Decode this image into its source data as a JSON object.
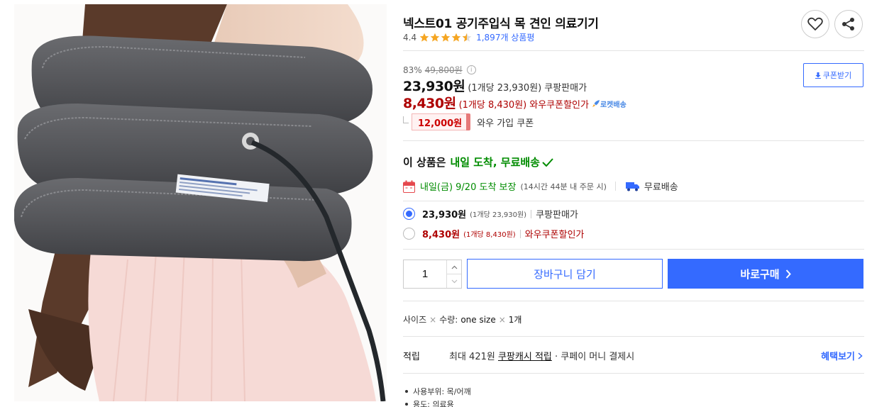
{
  "product": {
    "title": "넥스트01 공기주입식 목 견인 의료기기",
    "rating": "4.4",
    "review_count": "1,897개 상품평",
    "stars_icon": "star-rating-icon"
  },
  "actions": {
    "wishlist_icon": "heart-icon",
    "share_icon": "share-icon"
  },
  "pricing": {
    "discount_rate": "83%",
    "original_price": "49,800원",
    "coupon_button": "쿠폰받기",
    "sale_price": "23,930원",
    "sale_unit": "(1개당 23,930원)",
    "sale_label": "쿠팡판매가",
    "wow_price": "8,430원",
    "wow_unit": "(1개당 8,430원)",
    "wow_label": "와우쿠폰할인가",
    "rocket_badge": "로켓배송",
    "coupon_amount": "12,000원",
    "coupon_text": "와우 가입 쿠폰"
  },
  "delivery": {
    "heading_prefix": "이 상품은",
    "heading_highlight": "내일 도착, 무료배송",
    "arrival": "내일(금) 9/20 도착 보장",
    "arrival_note": "(14시간 44분 내 주문 시)",
    "free_shipping": "무료배송"
  },
  "options": [
    {
      "price": "23,930원",
      "unit": "(1개당 23,930원)",
      "label": "쿠팡판매가",
      "selected": true
    },
    {
      "price": "8,430원",
      "unit": "(1개당 8,430원)",
      "label": "와우쿠폰할인가",
      "selected": false
    }
  ],
  "purchase": {
    "quantity": "1",
    "cart_button": "장바구니 담기",
    "buy_button": "바로구매"
  },
  "selection": {
    "size_label": "사이즈",
    "qty_label": "수량:",
    "size_value": "one size",
    "qty_value": "1개"
  },
  "points": {
    "label": "적립",
    "text_prefix": "최대 421원",
    "text_link": "쿠팡캐시 적립",
    "text_suffix": "· 쿠페이 머니 결제시",
    "benefit_link": "혜택보기"
  },
  "specs": [
    "사용부위: 목/어깨",
    "용도: 의료용"
  ],
  "colors": {
    "accent_blue": "#346aff",
    "price_red": "#ae0000",
    "delivery_green": "#008c00"
  }
}
